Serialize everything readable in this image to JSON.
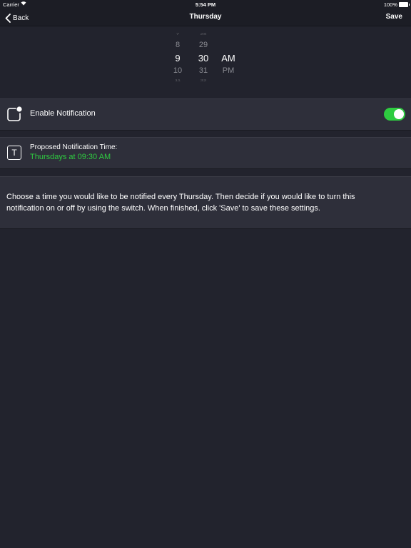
{
  "status_bar": {
    "carrier": "Carrier",
    "time": "5:54 PM",
    "battery": "100%"
  },
  "nav": {
    "back_label": "Back",
    "title": "Thursday",
    "save_label": "Save"
  },
  "picker": {
    "hours": [
      "7",
      "8",
      "9",
      "10",
      "11"
    ],
    "minutes": [
      "28",
      "29",
      "30",
      "31",
      "32"
    ],
    "ampm": [
      "",
      "",
      "AM",
      "PM",
      ""
    ],
    "selected": {
      "hour": "9",
      "minute": "30",
      "period": "AM"
    }
  },
  "notification": {
    "label": "Enable Notification",
    "enabled": true
  },
  "proposed": {
    "label": "Proposed Notification Time:",
    "value": "Thursdays at 09:30 AM",
    "icon_letter": "T"
  },
  "description": "Choose a time you would like to be notified every Thursday. Then decide if you would like to turn this notification on or off by using the switch. When finished, click 'Save' to save these settings.",
  "colors": {
    "background": "#22232d",
    "section": "#2e2f3a",
    "accent_green": "#2ecc40"
  }
}
